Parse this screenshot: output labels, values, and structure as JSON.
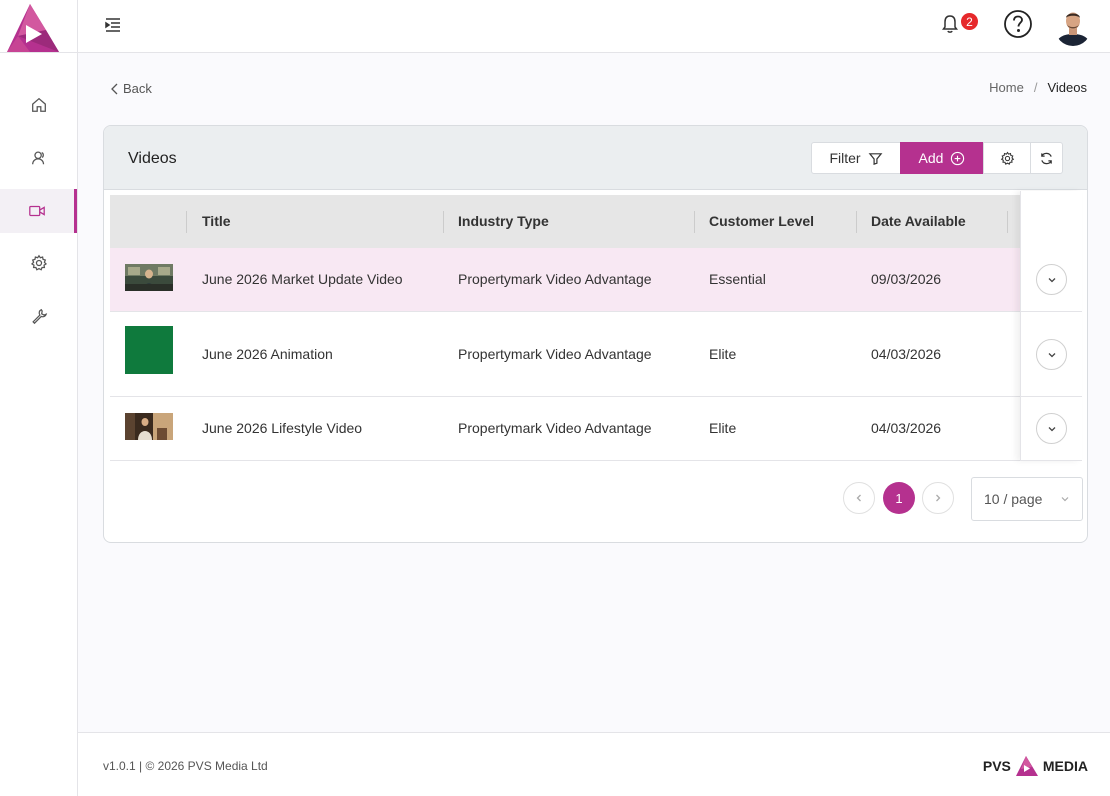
{
  "header": {
    "notification_count": "2"
  },
  "nav": {
    "back_label": "Back",
    "breadcrumb": [
      "Home",
      "/",
      "Videos"
    ]
  },
  "sidebar": {
    "items": [
      {
        "icon": "home-icon"
      },
      {
        "icon": "users-icon"
      },
      {
        "icon": "video-icon",
        "active": true
      },
      {
        "icon": "settings-icon"
      },
      {
        "icon": "tools-icon"
      }
    ]
  },
  "card": {
    "title": "Videos",
    "toolbar": {
      "filter_label": "Filter",
      "add_label": "Add"
    }
  },
  "table": {
    "columns": [
      "Title",
      "Industry Type",
      "Customer Level",
      "Date Available"
    ],
    "rows": [
      {
        "title": "June 2026 Market Update Video",
        "industry": "Propertymark Video Advantage",
        "level": "Essential",
        "date": "09/03/2026",
        "thumb": "photo-dark",
        "highlighted": true
      },
      {
        "title": "June 2026 Animation",
        "industry": "Propertymark Video Advantage",
        "level": "Elite",
        "date": "04/03/2026",
        "thumb": "green"
      },
      {
        "title": "June 2026 Lifestyle Video",
        "industry": "Propertymark Video Advantage",
        "level": "Elite",
        "date": "04/03/2026",
        "thumb": "photo-warm"
      }
    ]
  },
  "pagination": {
    "current_page": "1",
    "page_size_label": "10 / page"
  },
  "footer": {
    "version": "v1.0.1 | © 2026 PVS Media Ltd",
    "brand_left": "PVS",
    "brand_right": "MEDIA"
  },
  "colors": {
    "accent": "#b5318f",
    "badge": "#e6282b",
    "row_highlight": "#f8e8f3"
  }
}
